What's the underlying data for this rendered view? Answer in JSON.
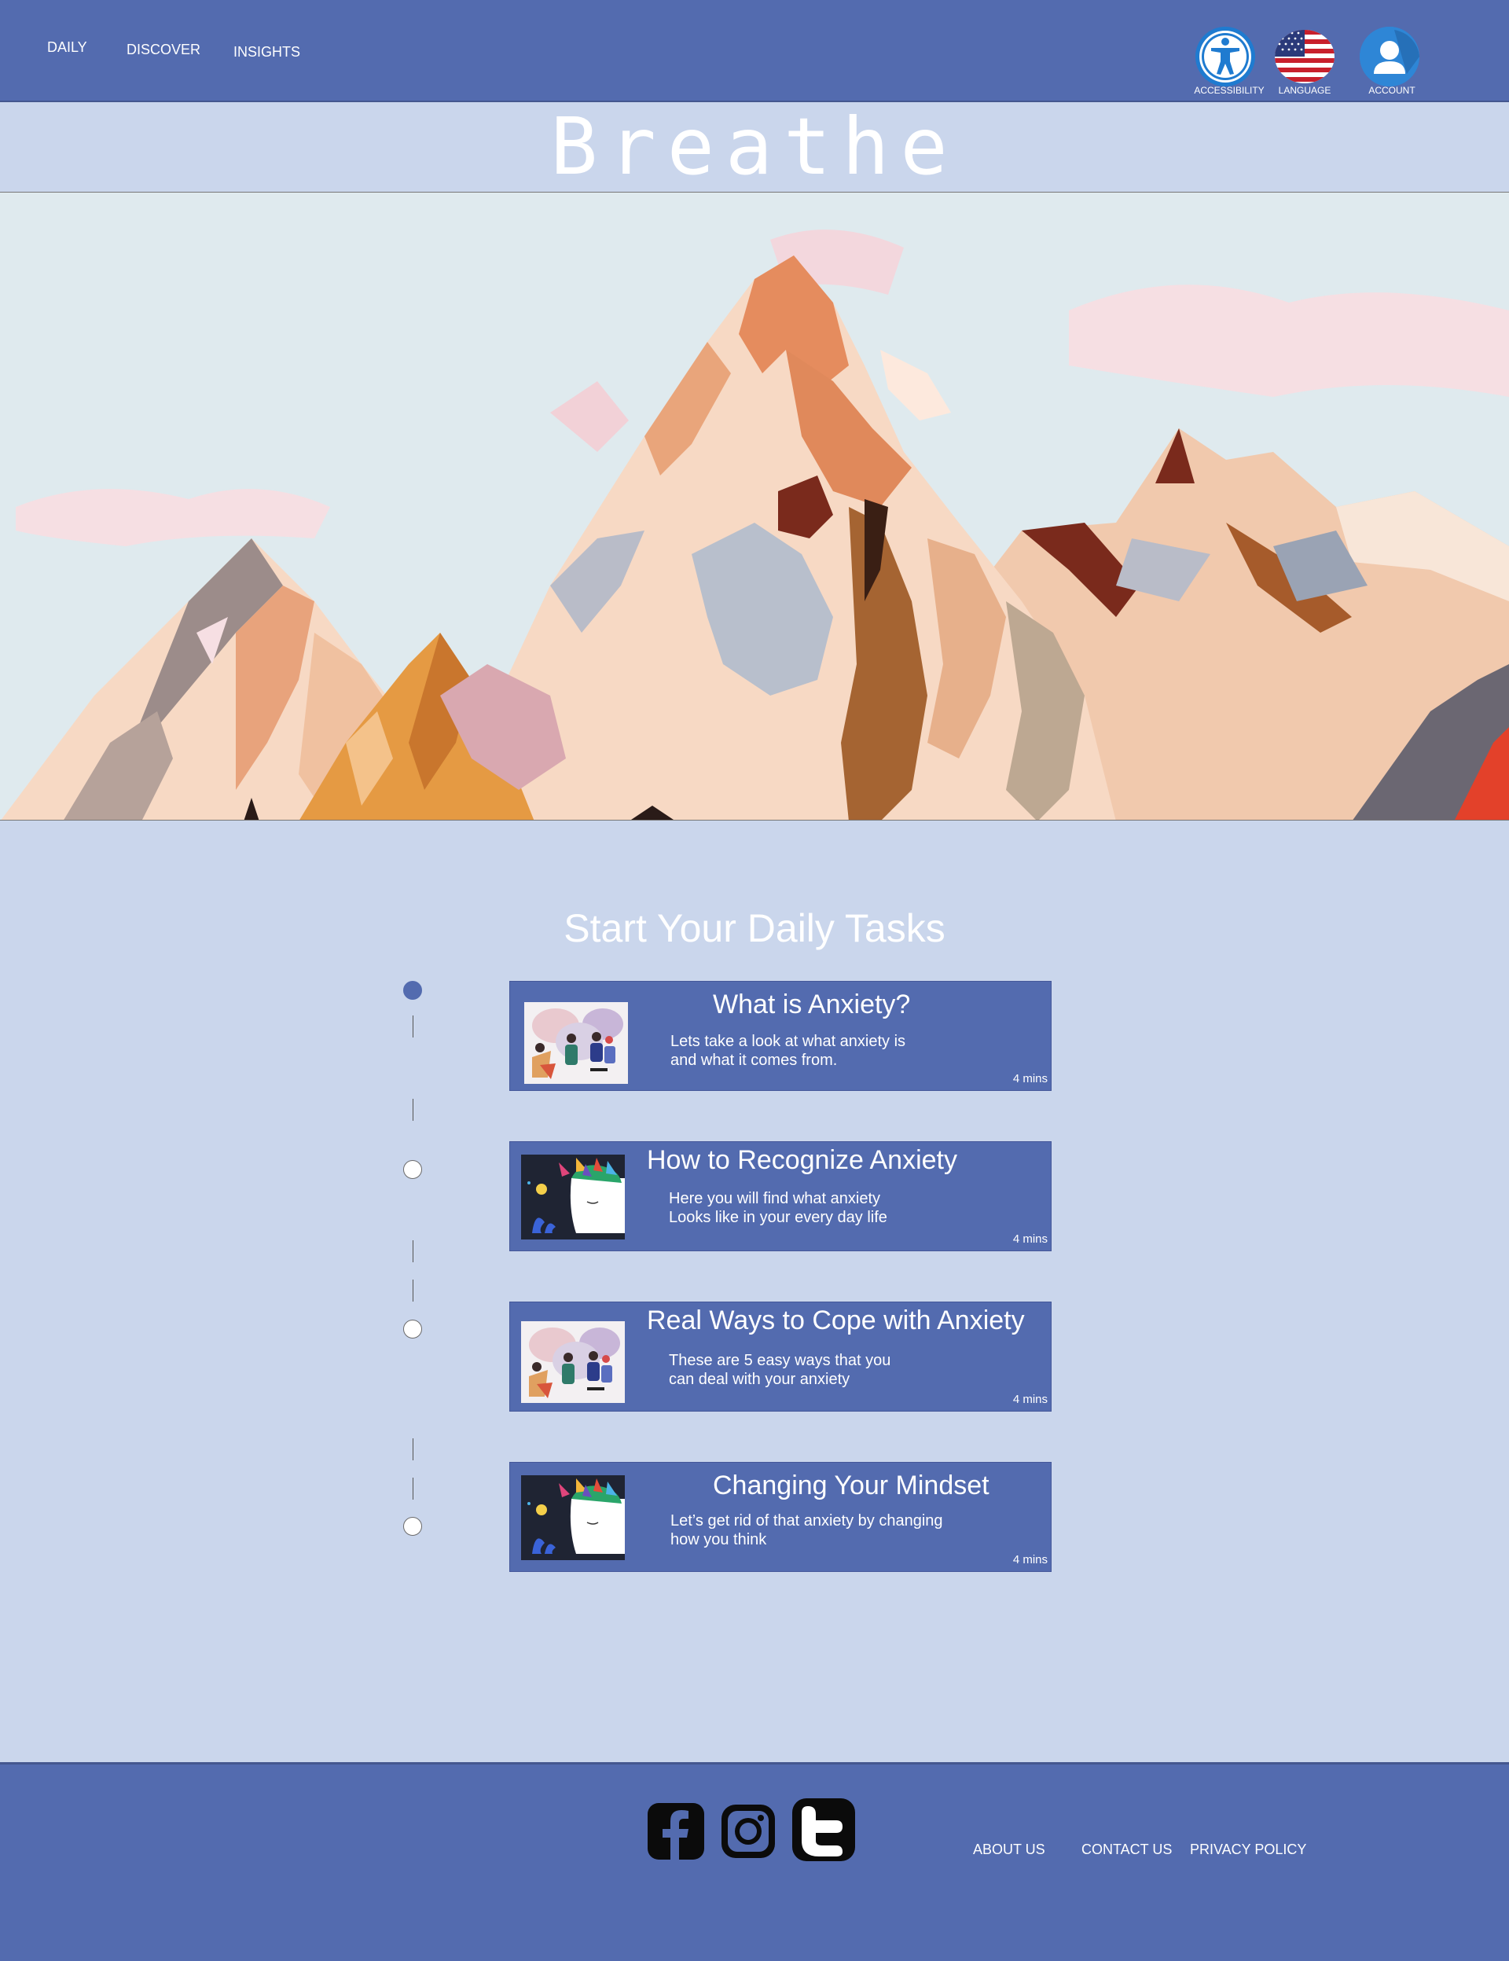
{
  "nav": {
    "items": [
      {
        "label": "DAILY"
      },
      {
        "label": "DISCOVER"
      },
      {
        "label": "INSIGHTS"
      }
    ]
  },
  "header_actions": {
    "accessibility": "ACCESSIBILITY",
    "language": "LANGUAGE",
    "account": "ACCOUNT"
  },
  "brand": {
    "title": "Breathe"
  },
  "tasks": {
    "heading": "Start Your Daily Tasks",
    "items": [
      {
        "title": "What is Anxiety?",
        "desc_line1": "Lets take a look at what anxiety is",
        "desc_line2": "and what it comes from.",
        "duration": "4 mins",
        "status": "current"
      },
      {
        "title": "How to Recognize Anxiety",
        "desc_line1": "Here you will find what anxiety",
        "desc_line2": "Looks like in your every day life",
        "duration": "4 mins",
        "status": "upcoming"
      },
      {
        "title": "Real Ways to Cope with Anxiety",
        "desc_line1": "These are 5 easy ways that you",
        "desc_line2": "can deal with your anxiety",
        "duration": "4 mins",
        "status": "upcoming"
      },
      {
        "title": "Changing Your Mindset",
        "desc_line1": "Let’s get rid of that anxiety by changing",
        "desc_line2": "how you think",
        "duration": "4 mins",
        "status": "upcoming"
      }
    ]
  },
  "footer": {
    "social_icons": [
      "facebook-icon",
      "instagram-icon",
      "twitter-icon"
    ],
    "links": [
      {
        "label": "ABOUT US"
      },
      {
        "label": "CONTACT US"
      },
      {
        "label": "PRIVACY POLICY"
      }
    ]
  },
  "colors": {
    "primary": "#536baf",
    "background": "#cad6ec",
    "text_light": "#ffffff"
  }
}
